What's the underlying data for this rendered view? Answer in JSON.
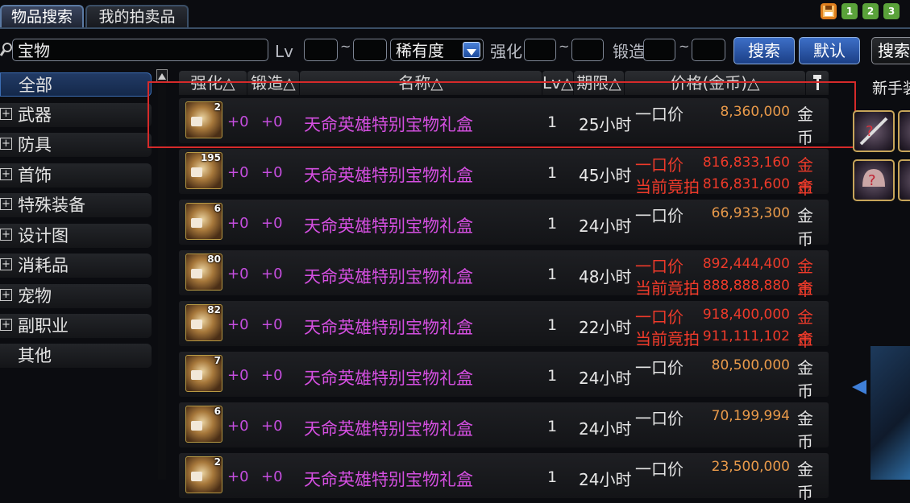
{
  "tabs": [
    {
      "label": "物品搜索",
      "active": true
    },
    {
      "label": "我的拍卖品",
      "active": false
    }
  ],
  "top_icons": {
    "pages": [
      "1",
      "2",
      "3"
    ]
  },
  "search": {
    "query": "宝物",
    "lv_label": "Lv",
    "lv_min": "",
    "lv_max": "",
    "tilde": "~",
    "rarity_select": "稀有度",
    "enhance_label": "强化",
    "forge_label": "锻造",
    "search_button": "搜索",
    "default_button": "默认",
    "extra_button": "搜索"
  },
  "sidebar": {
    "items": [
      {
        "label": "全部",
        "expandable": false,
        "active": true
      },
      {
        "label": "武器",
        "expandable": true
      },
      {
        "label": "防具",
        "expandable": true
      },
      {
        "label": "首饰",
        "expandable": true
      },
      {
        "label": "特殊装备",
        "expandable": true
      },
      {
        "label": "设计图",
        "expandable": true
      },
      {
        "label": "消耗品",
        "expandable": true
      },
      {
        "label": "宠物",
        "expandable": true
      },
      {
        "label": "副职业",
        "expandable": true
      },
      {
        "label": "其他",
        "expandable": false
      }
    ]
  },
  "columns": {
    "enhance": "强化△",
    "forge": "锻造△",
    "name": "名称△",
    "lv": "Lv△",
    "duration": "期限△",
    "price": "价格(金币)△"
  },
  "right_panel": {
    "title": "新手装"
  },
  "rows": [
    {
      "qty": "2",
      "enh": "+0",
      "forge": "+0",
      "name": "天命英雄特别宝物礼盒",
      "lv": "1",
      "dur": "25小时",
      "p1_label": "一口价",
      "p1": "8,360,000",
      "p1_unit": "金币",
      "p1_red": false,
      "p2_label": "",
      "p2": "",
      "p2_unit": ""
    },
    {
      "qty": "195",
      "enh": "+0",
      "forge": "+0",
      "name": "天命英雄特别宝物礼盒",
      "lv": "1",
      "dur": "45小时",
      "p1_label": "一口价",
      "p1": "816,833,160",
      "p1_unit": "金币",
      "p1_red": true,
      "p2_label": "当前竟拍",
      "p2": "816,831,600",
      "p2_unit": "金币"
    },
    {
      "qty": "6",
      "enh": "+0",
      "forge": "+0",
      "name": "天命英雄特别宝物礼盒",
      "lv": "1",
      "dur": "24小时",
      "p1_label": "一口价",
      "p1": "66,933,300",
      "p1_unit": "金币",
      "p1_red": false,
      "p2_label": "",
      "p2": "",
      "p2_unit": ""
    },
    {
      "qty": "80",
      "enh": "+0",
      "forge": "+0",
      "name": "天命英雄特别宝物礼盒",
      "lv": "1",
      "dur": "48小时",
      "p1_label": "一口价",
      "p1": "892,444,400",
      "p1_unit": "金币",
      "p1_red": true,
      "p2_label": "当前竟拍",
      "p2": "888,888,880",
      "p2_unit": "金币"
    },
    {
      "qty": "82",
      "enh": "+0",
      "forge": "+0",
      "name": "天命英雄特别宝物礼盒",
      "lv": "1",
      "dur": "22小时",
      "p1_label": "一口价",
      "p1": "918,400,000",
      "p1_unit": "金币",
      "p1_red": true,
      "p2_label": "当前竟拍",
      "p2": "911,111,102",
      "p2_unit": "金币"
    },
    {
      "qty": "7",
      "enh": "+0",
      "forge": "+0",
      "name": "天命英雄特别宝物礼盒",
      "lv": "1",
      "dur": "24小时",
      "p1_label": "一口价",
      "p1": "80,500,000",
      "p1_unit": "金币",
      "p1_red": false,
      "p2_label": "",
      "p2": "",
      "p2_unit": ""
    },
    {
      "qty": "6",
      "enh": "+0",
      "forge": "+0",
      "name": "天命英雄特别宝物礼盒",
      "lv": "1",
      "dur": "24小时",
      "p1_label": "一口价",
      "p1": "70,199,994",
      "p1_unit": "金币",
      "p1_red": false,
      "p2_label": "",
      "p2": "",
      "p2_unit": ""
    },
    {
      "qty": "2",
      "enh": "+0",
      "forge": "+0",
      "name": "天命英雄特别宝物礼盒",
      "lv": "1",
      "dur": "24小时",
      "p1_label": "一口价",
      "p1": "23,500,000",
      "p1_unit": "金币",
      "p1_red": false,
      "p2_label": "",
      "p2": "",
      "p2_unit": ""
    }
  ],
  "colors": {
    "accent": "#3d6fc7",
    "name": "#d44fe0",
    "price": "#e99a4a",
    "price_red": "#ee3a2a",
    "highlight_box": "#d62a2a"
  }
}
